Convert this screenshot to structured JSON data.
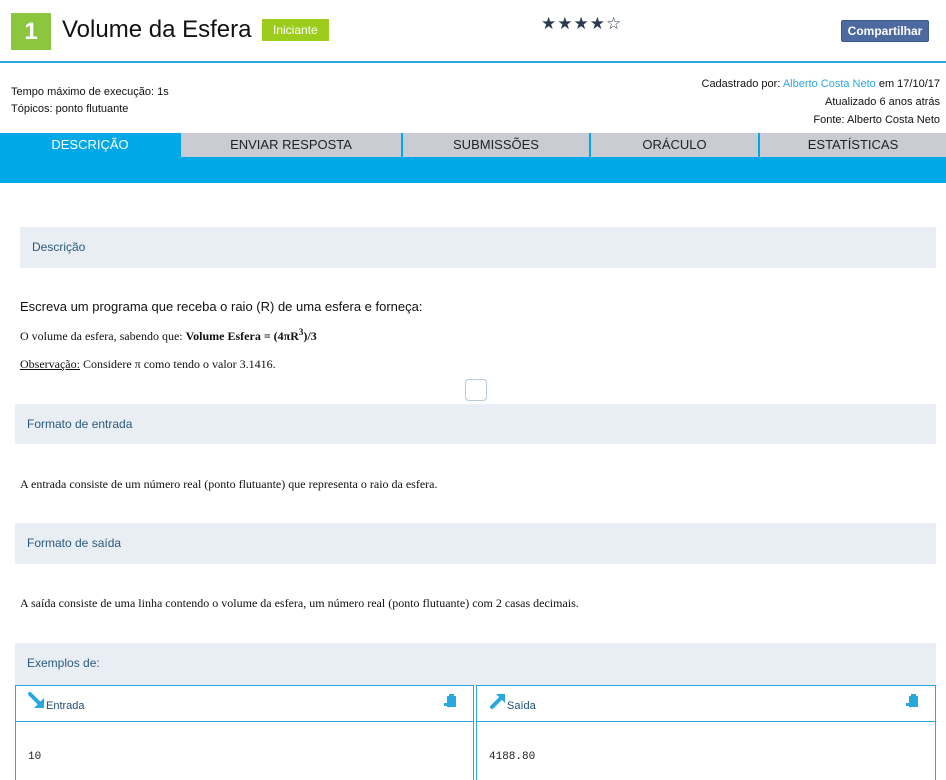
{
  "header": {
    "problem_number": "1",
    "title": "Volume da Esfera",
    "level": "Iniciante",
    "stars": "★★★★☆",
    "share_label": "Compartilhar"
  },
  "meta": {
    "time_limit": "Tempo máximo de execução: 1s",
    "topics": "Tópicos: ponto flutuante",
    "registered_prefix": "Cadastrado por: ",
    "author": "Alberto Costa Neto",
    "registered_suffix": " em 17/10/17",
    "updated": "Atualizado 6 anos atrás",
    "source": "Fonte: Alberto Costa Neto"
  },
  "tabs": [
    {
      "label": "DESCRIÇÃO",
      "active": true
    },
    {
      "label": "ENVIAR RESPOSTA",
      "active": false
    },
    {
      "label": "SUBMISSÕES",
      "active": false
    },
    {
      "label": "ORÁCULO",
      "active": false
    },
    {
      "label": "ESTATÍSTICAS",
      "active": false
    }
  ],
  "description": {
    "heading": "Descrição",
    "intro": "Escreva um programa que receba o raio (R) de uma esfera e forneça:",
    "volume_prefix": "O volume da esfera, sabendo que: ",
    "volume_formula_a": "Volume Esfera = (4πR",
    "volume_formula_exp": "3",
    "volume_formula_b": ")/3",
    "obs_label": "Observação:",
    "obs_text": " Considere π como tendo o valor 3.1416."
  },
  "input_format": {
    "heading": "Formato de entrada",
    "text": "A entrada consiste de um número real (ponto flutuante) que representa o raio da esfera."
  },
  "output_format": {
    "heading": "Formato de saída",
    "text": "A saída consiste de uma linha contendo o volume da esfera, um número real (ponto flutuante) com 2 casas decimais."
  },
  "examples": {
    "heading": "Exemplos de:",
    "input_label": "Entrada",
    "output_label": "Saída",
    "input_value": "10",
    "output_value": "4188.80"
  },
  "colors": {
    "accent": "#00a8e8",
    "badge_green": "#8cc63f",
    "level_green": "#9ccc1c",
    "section_bg": "#e8eef3"
  }
}
